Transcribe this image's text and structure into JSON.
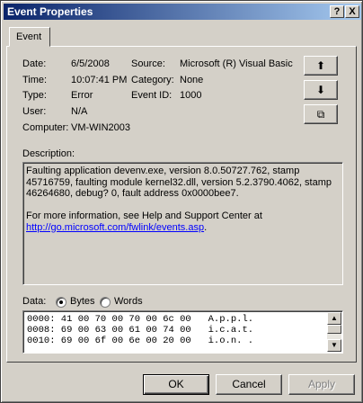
{
  "window": {
    "title": "Event Properties",
    "help_glyph": "?",
    "close_glyph": "X"
  },
  "tab": {
    "label": "Event"
  },
  "fields": {
    "date_label": "Date:",
    "date": "6/5/2008",
    "time_label": "Time:",
    "time": "10:07:41 PM",
    "type_label": "Type:",
    "type": "Error",
    "user_label": "User:",
    "user": "N/A",
    "computer_label": "Computer:",
    "computer": "VM-WIN2003",
    "source_label": "Source:",
    "source": "Microsoft (R) Visual Basic",
    "category_label": "Category:",
    "category": "None",
    "eventid_label": "Event ID:",
    "eventid": "1000"
  },
  "side_buttons": {
    "up_glyph": "⬆",
    "down_glyph": "⬇",
    "copy_glyph": "⧉"
  },
  "description": {
    "label": "Description:",
    "text": "Faulting application devenv.exe, version 8.0.50727.762, stamp 45716759, faulting module kernel32.dll, version 5.2.3790.4062, stamp 46264680, debug? 0, fault address 0x0000bee7.\n\nFor more information, see Help and Support Center at",
    "link": "http://go.microsoft.com/fwlink/events.asp",
    "link_suffix": "."
  },
  "data": {
    "label": "Data:",
    "bytes_label": "Bytes",
    "words_label": "Words",
    "selected": "Bytes",
    "rows": [
      "0000: 41 00 70 00 70 00 6c 00   A.p.p.l.",
      "0008: 69 00 63 00 61 00 74 00   i.c.a.t.",
      "0010: 69 00 6f 00 6e 00 20 00   i.o.n. ."
    ]
  },
  "buttons": {
    "ok": "OK",
    "cancel": "Cancel",
    "apply": "Apply"
  }
}
